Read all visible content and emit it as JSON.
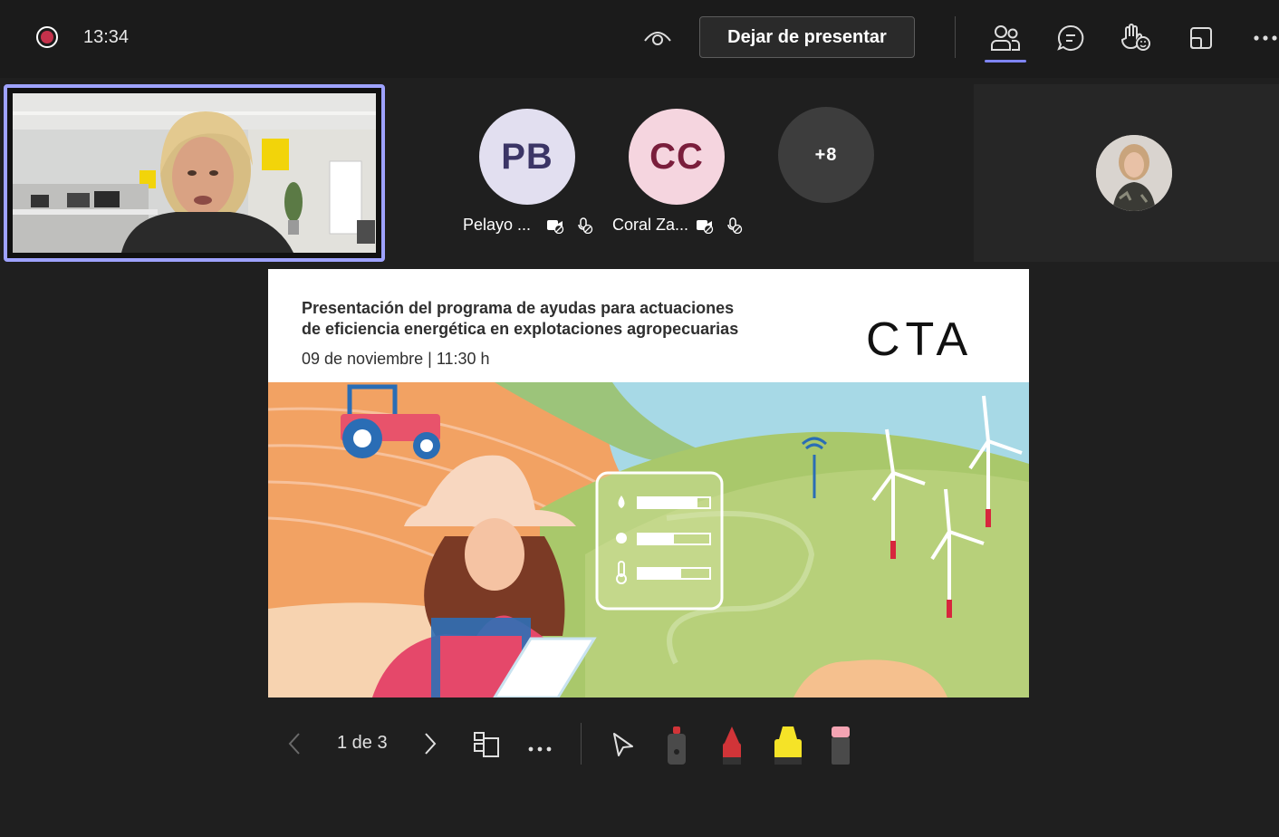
{
  "topbar": {
    "time": "13:34",
    "present_button": "Dejar de presentar",
    "icons": [
      "record-icon",
      "eye-icon",
      "people-icon",
      "chat-icon",
      "raise-hand-reaction-icon",
      "layout-icon",
      "more-icon"
    ]
  },
  "participants": [
    {
      "initials": "PB",
      "name": "Pelayo ...",
      "bg": "#e2dff0",
      "fg": "#3b3566"
    },
    {
      "initials": "CC",
      "name": "Coral Za...",
      "bg": "#f5d5df",
      "fg": "#7a1e3c"
    },
    {
      "initials": "+8",
      "name": "",
      "bg": "#3d3d3d",
      "fg": "#ffffff"
    }
  ],
  "slide": {
    "title_line1": "Presentación del programa de ayudas para actuaciones",
    "title_line2": "de eficiencia energética en explotaciones agropecuarias",
    "date_part1": "09 de noviembre",
    "date_sep": "|",
    "date_part2": "11:30 h",
    "logo": "CTA"
  },
  "controls": {
    "page_indicator": "1 de 3",
    "tools": [
      "prev-arrow-icon",
      "next-arrow-icon",
      "slide-grid-icon",
      "more-icon",
      "pointer-icon",
      "laser-pointer-icon",
      "red-pen-icon",
      "yellow-highlighter-icon",
      "eraser-icon"
    ]
  },
  "colors": {
    "accent": "#7f85f5",
    "record": "#c4314b",
    "background": "#1f1f1f"
  }
}
